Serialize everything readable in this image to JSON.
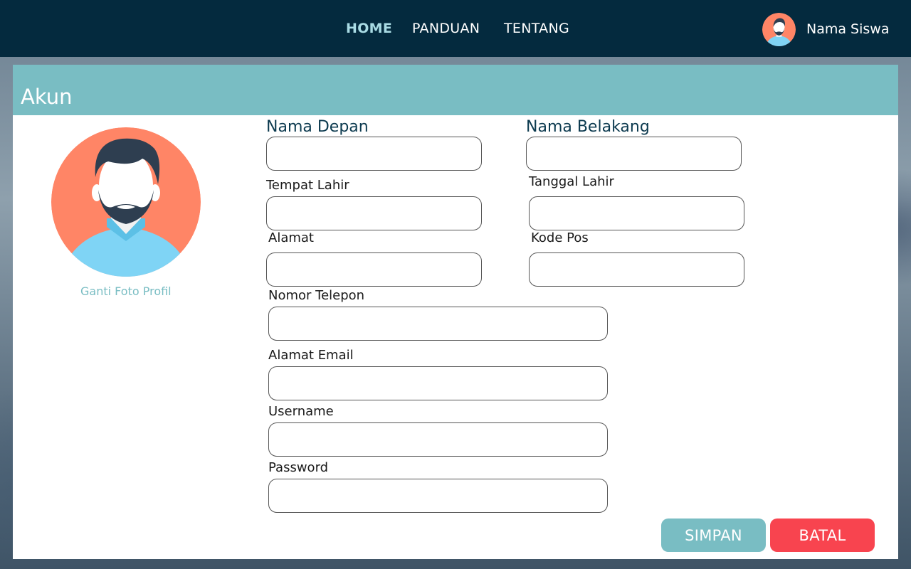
{
  "nav": {
    "home": "HOME",
    "panduan": "PANDUAN",
    "tentang": "TENTANG"
  },
  "user": {
    "name": "Nama Siswa",
    "avatar_icon": "user-avatar-icon"
  },
  "card": {
    "title": "Akun",
    "change_photo": "Ganti Foto Profil",
    "profile_icon": "male-profile-avatar-icon"
  },
  "form": {
    "first_name": {
      "label": "Nama Depan",
      "value": ""
    },
    "last_name": {
      "label": "Nama Belakang",
      "value": ""
    },
    "birth_place": {
      "label": "Tempat Lahir",
      "value": ""
    },
    "birth_date": {
      "label": "Tanggal Lahir",
      "value": ""
    },
    "address": {
      "label": "Alamat",
      "value": ""
    },
    "postal_code": {
      "label": "Kode Pos",
      "value": ""
    },
    "phone": {
      "label": "Nomor Telepon",
      "value": ""
    },
    "email": {
      "label": "Alamat Email",
      "value": ""
    },
    "username": {
      "label": "Username",
      "value": ""
    },
    "password": {
      "label": "Password",
      "value": ""
    }
  },
  "buttons": {
    "save": "SIMPAN",
    "cancel": "BATAL"
  },
  "colors": {
    "topbar": "#042a3e",
    "accent": "#79bdc3",
    "nav_active": "#a9dbe4",
    "danger": "#f8444f",
    "avatar_bg": "#ff8566",
    "shirt": "#7fd4f5"
  }
}
